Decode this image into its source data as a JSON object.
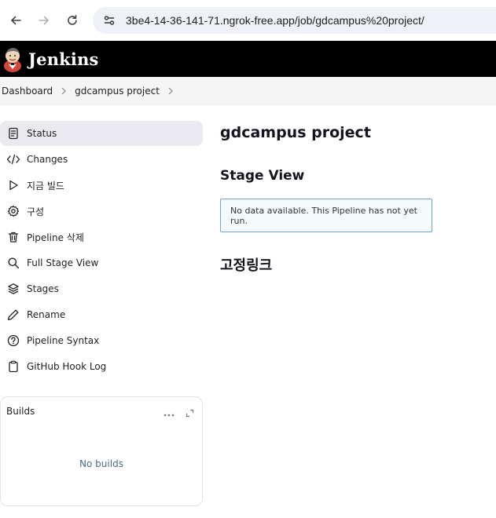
{
  "browser": {
    "url": "3be4-14-36-141-71.ngrok-free.app/job/gdcampus%20project/",
    "icons": [
      "back-arrow-icon",
      "forward-arrow-icon",
      "reload-icon",
      "site-settings-icon"
    ]
  },
  "header": {
    "title": "Jenkins",
    "logo_icon": "jenkins-butler-logo",
    "background": "#000000"
  },
  "breadcrumb": {
    "items": [
      "Dashboard",
      "gdcampus project"
    ]
  },
  "sidebar": {
    "items": [
      {
        "label": "Status",
        "icon": "document-icon",
        "active": true
      },
      {
        "label": "Changes",
        "icon": "code-icon"
      },
      {
        "label": "지금 빌드",
        "icon": "play-icon"
      },
      {
        "label": "구성",
        "icon": "gear-icon"
      },
      {
        "label": "Pipeline 삭제",
        "icon": "trash-icon"
      },
      {
        "label": "Full Stage View",
        "icon": "search-icon"
      },
      {
        "label": "Stages",
        "icon": "layers-icon"
      },
      {
        "label": "Rename",
        "icon": "pencil-icon"
      },
      {
        "label": "Pipeline Syntax",
        "icon": "help-circle-icon"
      },
      {
        "label": "GitHub Hook Log",
        "icon": "clipboard-icon"
      }
    ]
  },
  "builds": {
    "title": "Builds",
    "empty_text": "No builds",
    "icons": [
      "more-icon",
      "expand-icon"
    ]
  },
  "main": {
    "title": "gdcampus project",
    "stage_view_title": "Stage View",
    "stage_view_notice": "No data available. This Pipeline has not yet run.",
    "permalinks_title": "고정링크"
  }
}
